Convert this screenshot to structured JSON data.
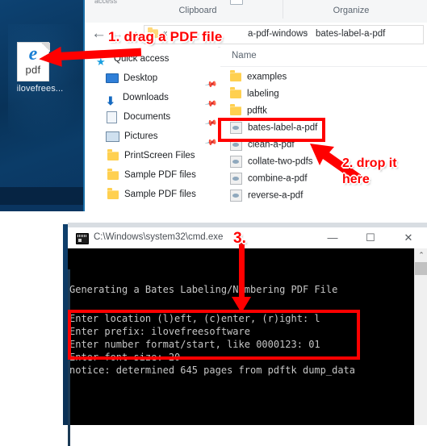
{
  "desktop": {
    "icon": {
      "glyph": "e",
      "type_label": "pdf",
      "caption": "ilovefrees...",
      "icon_name": "edge-pdf-file-icon"
    }
  },
  "explorer": {
    "ribbon": {
      "partial_top_text": "access",
      "groups": [
        "Clipboard",
        "Organize"
      ]
    },
    "navbar": {
      "back_icon": "←",
      "forward_icon": "→",
      "up_icon": "▲",
      "breadcrumb_overflow": "«",
      "breadcrumb": [
        "a-pdf-windows",
        "bates-label-a-pdf"
      ],
      "breadcrumb_separator": "›"
    },
    "column_header": "Name",
    "collapse_chevron": "⌃",
    "nav_pane": [
      {
        "label": "Quick access",
        "icon": "star-icon",
        "pinned": false
      },
      {
        "label": "Desktop",
        "icon": "monitor-icon",
        "pinned": true
      },
      {
        "label": "Downloads",
        "icon": "download-arrow-icon",
        "pinned": true
      },
      {
        "label": "Documents",
        "icon": "document-icon",
        "pinned": true
      },
      {
        "label": "Pictures",
        "icon": "picture-icon",
        "pinned": true
      },
      {
        "label": "PrintScreen Files",
        "icon": "folder-icon",
        "pinned": false
      },
      {
        "label": "Sample PDF files",
        "icon": "folder-icon",
        "pinned": false
      },
      {
        "label": "Sample PDF files",
        "icon": "folder-icon",
        "pinned": false
      }
    ],
    "files": [
      {
        "name": "examples",
        "icon": "folder-icon",
        "kind": "folder"
      },
      {
        "name": "labeling",
        "icon": "folder-icon",
        "kind": "folder"
      },
      {
        "name": "pdftk",
        "icon": "folder-icon",
        "kind": "folder"
      },
      {
        "name": "bates-label-a-pdf",
        "icon": "batch-file-icon",
        "kind": "file"
      },
      {
        "name": "clean-a-pdf",
        "icon": "batch-file-icon",
        "kind": "file"
      },
      {
        "name": "collate-two-pdfs",
        "icon": "batch-file-icon",
        "kind": "file"
      },
      {
        "name": "combine-a-pdf",
        "icon": "batch-file-icon",
        "kind": "file"
      },
      {
        "name": "reverse-a-pdf",
        "icon": "batch-file-icon",
        "kind": "file"
      }
    ]
  },
  "cmd": {
    "title": "C:\\Windows\\system32\\cmd.exe",
    "icon": "console-icon",
    "window_buttons": {
      "minimize": "—",
      "maximize": "☐",
      "close": "✕"
    },
    "scrollbar": {
      "up_arrow": "⌃"
    },
    "lines": [
      "Generating a Bates Labeling/Numbering PDF File",
      "Enter location (l)eft, (c)enter, (r)ight: l",
      "Enter prefix: ilovefreesoftware",
      "Enter number format/start, like 0000123: 01",
      "Enter font size: 20",
      "notice: determined 645 pages from pdftk dump_data"
    ]
  },
  "annotations": {
    "accent_color": "#ff0000",
    "step1": "1. drag a PDF file",
    "step2_line1": "2. drop it",
    "step2_line2": "here",
    "step3": "3."
  }
}
